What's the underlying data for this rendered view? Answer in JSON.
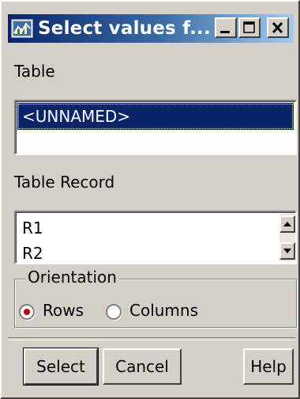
{
  "window": {
    "title": "Select values f...",
    "controls": [
      "minimize",
      "maximize",
      "close"
    ]
  },
  "table_section": {
    "label": "Table",
    "items": [
      "<UNNAMED>"
    ],
    "selected": "<UNNAMED>"
  },
  "record_section": {
    "label": "Table Record",
    "items": [
      "R1",
      "R2"
    ]
  },
  "orientation": {
    "legend": "Orientation",
    "options": [
      "Rows",
      "Columns"
    ],
    "selected": "Rows"
  },
  "buttons": {
    "select": "Select",
    "cancel": "Cancel",
    "help": "Help"
  },
  "colors": {
    "titlebar_start": "#0a246a",
    "titlebar_end": "#a6caf0",
    "selection": "#0a246a",
    "radio_dot": "#c00000",
    "face": "#d4d0c8"
  }
}
